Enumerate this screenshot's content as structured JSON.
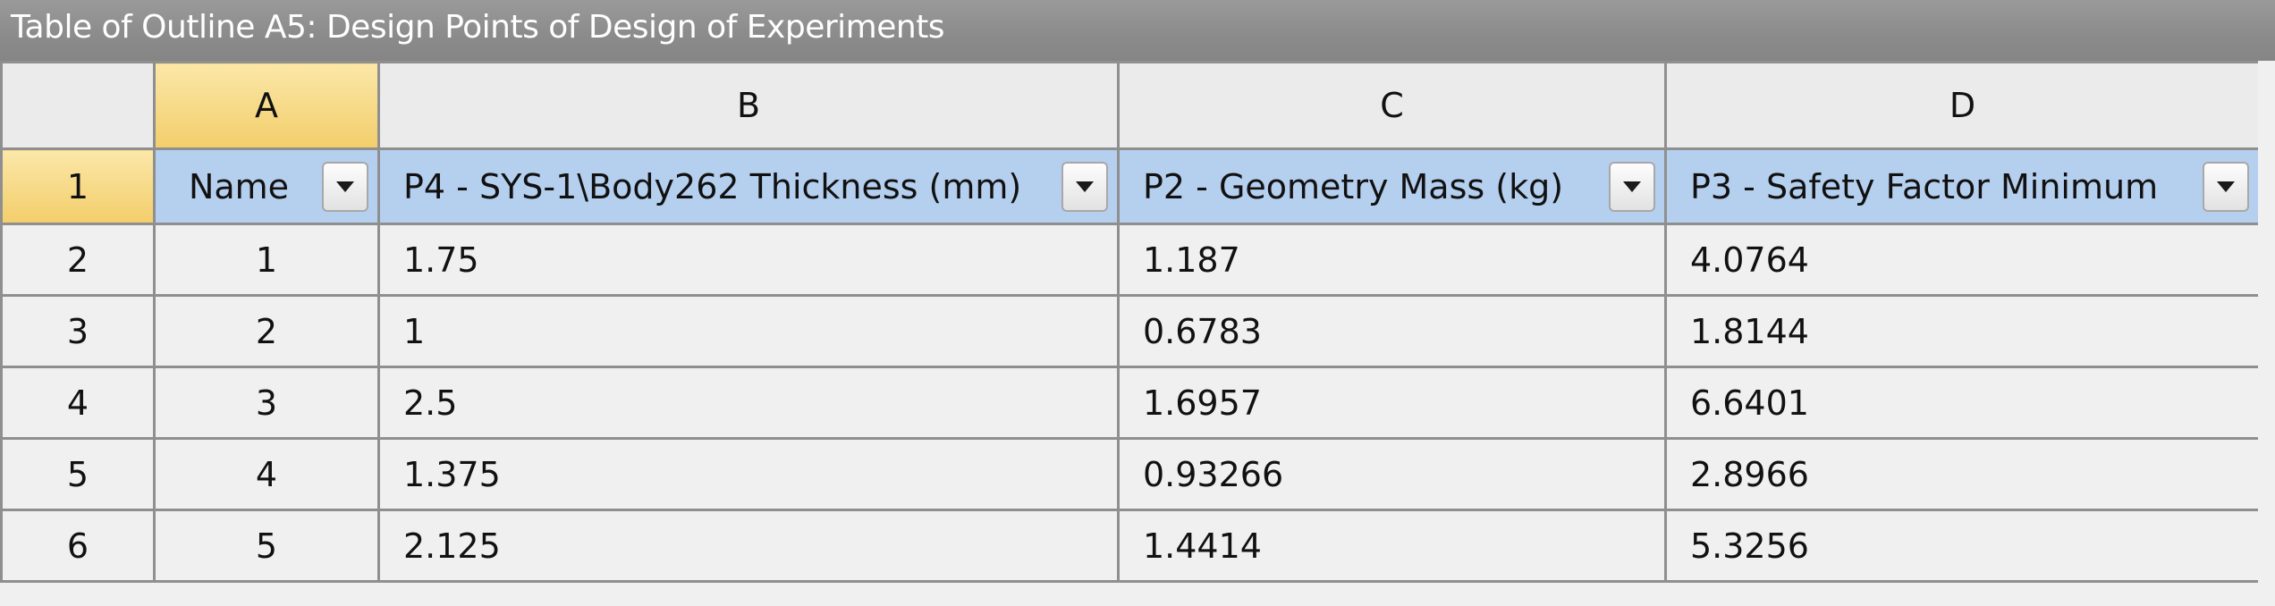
{
  "window": {
    "title": "Table of Outline A5: Design Points of Design of Experiments"
  },
  "columns": [
    "A",
    "B",
    "C",
    "D"
  ],
  "selected_column": "A",
  "parameter_row": {
    "row_number": "1",
    "headers": [
      "Name",
      "P4 - SYS-1\\Body262 Thickness (mm)",
      "P2 - Geometry Mass (kg)",
      "P3 - Safety Factor Minimum"
    ],
    "dropdown_icon": "triangle-down-icon"
  },
  "rows": [
    {
      "row_number": "2",
      "cells": [
        "1",
        "1.75",
        "1.187",
        "4.0764"
      ]
    },
    {
      "row_number": "3",
      "cells": [
        "2",
        "1",
        "0.6783",
        "1.8144"
      ]
    },
    {
      "row_number": "4",
      "cells": [
        "3",
        "2.5",
        "1.6957",
        "6.6401"
      ]
    },
    {
      "row_number": "5",
      "cells": [
        "4",
        "1.375",
        "0.93266",
        "2.8966"
      ]
    },
    {
      "row_number": "6",
      "cells": [
        "5",
        "2.125",
        "1.4414",
        "5.3256"
      ]
    }
  ],
  "colors": {
    "title_bar": "#8c8c8c",
    "selected_header": "#f3ce6b",
    "parameter_header": "#b5cfef",
    "grid_line": "#8f8f8f"
  }
}
